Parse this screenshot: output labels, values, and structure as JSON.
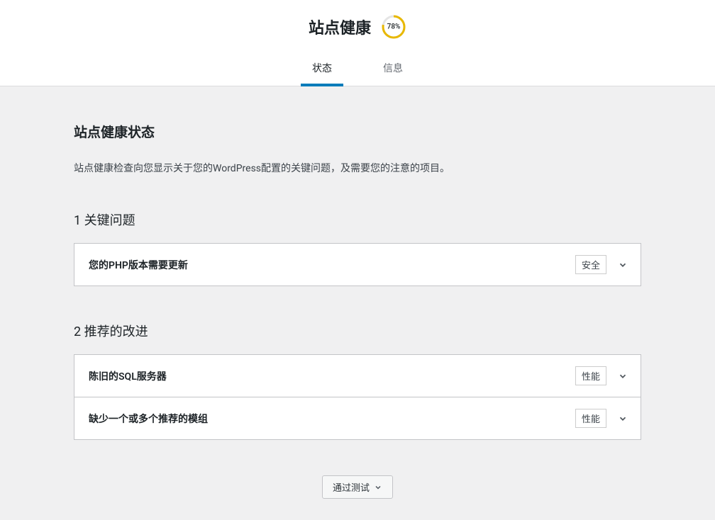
{
  "header": {
    "title": "站点健康",
    "progress_percent": "78%",
    "progress_value": 78
  },
  "tabs": {
    "status": "状态",
    "info": "信息"
  },
  "main": {
    "heading": "站点健康状态",
    "description": "站点健康检查向您显示关于您的WordPress配置的关键问题，及需要您的注意的项目。"
  },
  "critical": {
    "title": "1 关键问题",
    "items": [
      {
        "label": "您的PHP版本需要更新",
        "badge": "安全"
      }
    ]
  },
  "recommended": {
    "title": "2 推荐的改进",
    "items": [
      {
        "label": "陈旧的SQL服务器",
        "badge": "性能"
      },
      {
        "label": "缺少一个或多个推荐的模组",
        "badge": "性能"
      }
    ]
  },
  "footer": {
    "passed_label": "通过测试"
  }
}
